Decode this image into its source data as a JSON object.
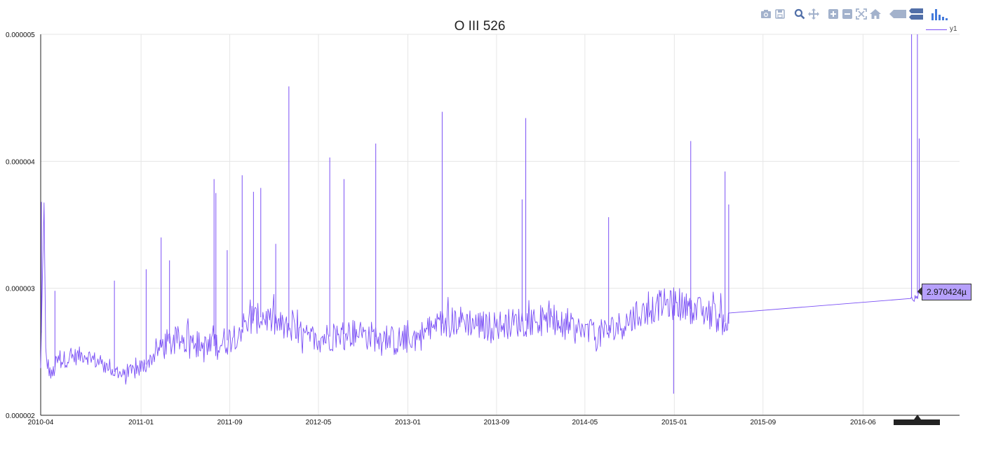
{
  "chart_data": {
    "type": "line",
    "title": "O III 526",
    "series": [
      {
        "name": "y1",
        "color": "#7a4ff5",
        "points": [
          [
            "2010-04-01",
            2.35e-06
          ],
          [
            "2010-04-10",
            3.7e-06
          ],
          [
            "2010-04-15",
            2.45e-06
          ],
          [
            "2010-05-01",
            2.3e-06
          ],
          [
            "2010-05-15",
            2.42e-06
          ],
          [
            "2010-06-15",
            2.45e-06
          ],
          [
            "2010-08-01",
            2.48e-06
          ],
          [
            "2010-09-15",
            2.4e-06
          ],
          [
            "2010-10-15",
            2.35e-06
          ],
          [
            "2010-11-15",
            2.3e-06
          ],
          [
            "2010-12-15",
            2.35e-06
          ],
          [
            "2011-01-15",
            2.4e-06
          ],
          [
            "2011-03-01",
            2.55e-06
          ],
          [
            "2011-05-01",
            2.6e-06
          ],
          [
            "2011-07-01",
            2.52e-06
          ],
          [
            "2011-09-01",
            2.6e-06
          ],
          [
            "2011-10-15",
            2.72e-06
          ],
          [
            "2011-12-01",
            2.78e-06
          ],
          [
            "2012-02-01",
            2.68e-06
          ],
          [
            "2012-04-01",
            2.6e-06
          ],
          [
            "2012-06-01",
            2.62e-06
          ],
          [
            "2012-08-01",
            2.65e-06
          ],
          [
            "2012-10-01",
            2.62e-06
          ],
          [
            "2012-12-01",
            2.58e-06
          ],
          [
            "2013-02-01",
            2.62e-06
          ],
          [
            "2013-04-01",
            2.72e-06
          ],
          [
            "2013-06-01",
            2.75e-06
          ],
          [
            "2013-08-01",
            2.7e-06
          ],
          [
            "2013-10-01",
            2.72e-06
          ],
          [
            "2013-12-01",
            2.75e-06
          ],
          [
            "2014-02-01",
            2.72e-06
          ],
          [
            "2014-04-01",
            2.68e-06
          ],
          [
            "2014-06-01",
            2.62e-06
          ],
          [
            "2014-08-01",
            2.7e-06
          ],
          [
            "2014-10-01",
            2.8e-06
          ],
          [
            "2014-12-01",
            2.88e-06
          ],
          [
            "2015-02-01",
            2.85e-06
          ],
          [
            "2015-04-01",
            2.8e-06
          ],
          [
            "2015-05-31",
            2.72e-06
          ],
          [
            "2016-10-10",
            2.92e-06
          ],
          [
            "2016-10-25",
            2.95e-06
          ],
          [
            "2016-11-01",
            2.970424e-06
          ]
        ],
        "spikes": [
          [
            "2010-04-03",
            3.68e-06
          ],
          [
            "2010-05-10",
            2.98e-06
          ],
          [
            "2010-10-20",
            3.06e-06
          ],
          [
            "2011-01-15",
            3.15e-06
          ],
          [
            "2011-02-25",
            3.4e-06
          ],
          [
            "2011-03-20",
            3.22e-06
          ],
          [
            "2011-07-20",
            3.86e-06
          ],
          [
            "2011-07-25",
            3.75e-06
          ],
          [
            "2011-08-25",
            3.3e-06
          ],
          [
            "2011-10-05",
            3.89e-06
          ],
          [
            "2011-11-05",
            3.76e-06
          ],
          [
            "2011-11-25",
            3.79e-06
          ],
          [
            "2012-01-05",
            3.35e-06
          ],
          [
            "2012-02-10",
            4.59e-06
          ],
          [
            "2012-06-01",
            4.03e-06
          ],
          [
            "2012-07-10",
            3.86e-06
          ],
          [
            "2012-10-05",
            4.14e-06
          ],
          [
            "2013-04-05",
            4.39e-06
          ],
          [
            "2013-11-10",
            3.7e-06
          ],
          [
            "2013-11-20",
            4.34e-06
          ],
          [
            "2014-07-05",
            3.56e-06
          ],
          [
            "2014-12-30",
            2.17e-06
          ],
          [
            "2015-02-15",
            4.16e-06
          ],
          [
            "2015-05-20",
            3.92e-06
          ],
          [
            "2015-05-30",
            3.66e-06
          ],
          [
            "2016-10-12",
            5e-06
          ],
          [
            "2016-10-28",
            5e-06
          ],
          [
            "2016-11-02",
            4.18e-06
          ]
        ]
      }
    ],
    "x_tick_labels": [
      "2010-04",
      "2011-01",
      "2011-09",
      "2012-05",
      "2013-01",
      "2013-09",
      "2014-05",
      "2015-01",
      "2015-09",
      "2016-06"
    ],
    "y_tick_labels": [
      "0.000002",
      "0.000003",
      "0.000004",
      "0.000005"
    ],
    "y_ticks": [
      2e-06,
      3e-06,
      4e-06,
      5e-06
    ],
    "xlim": [
      "2010-04-01",
      "2016-11-01"
    ],
    "ylim": [
      2e-06,
      5e-06
    ],
    "grid": true,
    "legend_position": "top-right",
    "hover_label": "2.970424µ"
  },
  "modebar": {
    "icons": [
      "camera-icon",
      "save-icon",
      "zoom-icon",
      "pan-icon",
      "zoom-in-icon",
      "zoom-out-icon",
      "autoscale-icon",
      "home-icon",
      "hover-closest-icon",
      "hover-compare-icon",
      "plotly-logo-icon"
    ],
    "color": "#a3b2cc",
    "active_color": "#516fa8",
    "logo_color": "#447adb"
  }
}
